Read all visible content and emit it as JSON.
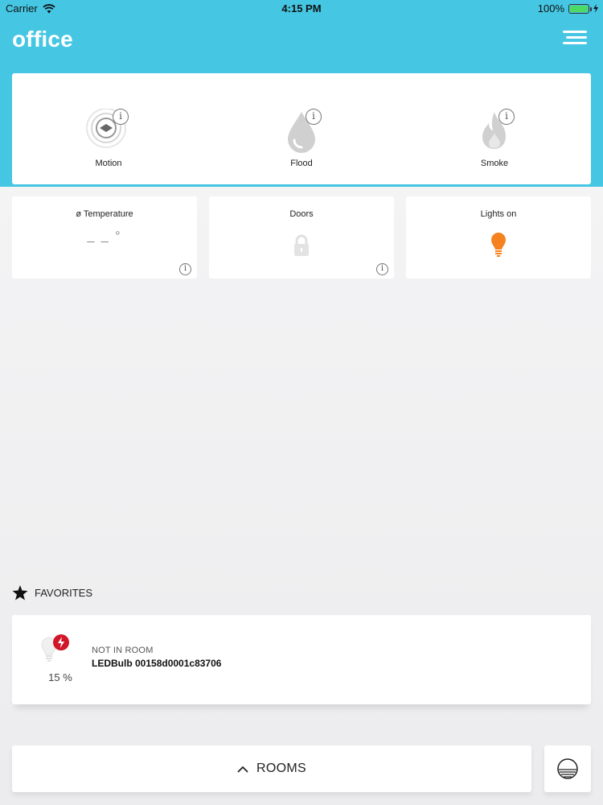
{
  "status_bar": {
    "carrier": "Carrier",
    "time": "4:15 PM",
    "battery": "100%"
  },
  "header": {
    "title": "office"
  },
  "alarms": [
    {
      "label": "Motion",
      "icon": "motion-sensor-icon"
    },
    {
      "label": "Flood",
      "icon": "water-drop-icon"
    },
    {
      "label": "Smoke",
      "icon": "flame-icon"
    }
  ],
  "stats": {
    "temperature": {
      "title": "ø Temperature",
      "value": "_ _ °"
    },
    "doors": {
      "title": "Doors",
      "icon": "lock-icon"
    },
    "lights": {
      "title": "Lights on",
      "icon": "lightbulb-icon"
    }
  },
  "favorites": {
    "heading": "FAVORITES",
    "items": [
      {
        "room": "NOT IN ROOM",
        "name": "LEDBulb 00158d0001c83706",
        "level": "15 %"
      }
    ]
  },
  "bottom": {
    "rooms_label": "ROOMS"
  },
  "colors": {
    "accent": "#45c6e3",
    "bulb_on": "#f5821f",
    "alert_red": "#d0172a"
  }
}
